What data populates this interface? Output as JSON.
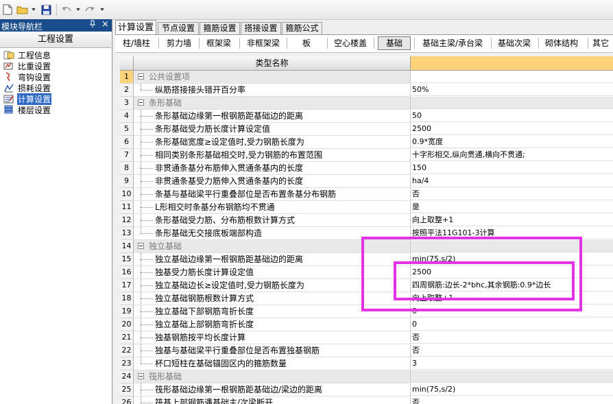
{
  "toolbar": {
    "icons": [
      "new-file-icon",
      "open-folder-icon",
      "save-icon",
      "undo-icon",
      "redo-icon"
    ]
  },
  "nav": {
    "title": "模块导航栏",
    "pin": "ą",
    "close": "×",
    "header": "工程设置",
    "items": [
      {
        "label": "工程信息",
        "icon": "project-info-icon"
      },
      {
        "label": "比重设置",
        "icon": "density-icon"
      },
      {
        "label": "弯钩设置",
        "icon": "hook-icon"
      },
      {
        "label": "损耗设置",
        "icon": "loss-icon"
      },
      {
        "label": "计算设置",
        "icon": "calc-settings-icon",
        "selected": true
      },
      {
        "label": "楼层设置",
        "icon": "floor-settings-icon"
      }
    ]
  },
  "tabs": [
    "计算设置",
    "节点设置",
    "箍筋设置",
    "搭接设置",
    "箍筋公式"
  ],
  "subtabs": [
    "柱/墙柱",
    "剪力墙",
    "框架梁",
    "非框架梁",
    "板",
    "空心楼盖",
    "基础",
    "基础主梁/承台梁",
    "基础次梁",
    "砌体结构",
    "其它"
  ],
  "grid": {
    "header_name": "类型名称",
    "rows": [
      {
        "n": "1",
        "name": "公共设置项",
        "value": "",
        "cat": true
      },
      {
        "n": "2",
        "name": "纵筋搭接接头错开百分率",
        "value": "50%"
      },
      {
        "n": "3",
        "name": "条形基础",
        "value": "",
        "cat": true
      },
      {
        "n": "4",
        "name": "条形基础边缘第一根钢筋距基础边的距离",
        "value": "50"
      },
      {
        "n": "5",
        "name": "条形基础受力筋长度计算设定值",
        "value": "2500"
      },
      {
        "n": "6",
        "name": "条形基础宽度≥设定值时,受力钢筋长度为",
        "value": "0.9*宽度"
      },
      {
        "n": "7",
        "name": "相同类别条形基础相交时,受力钢筋的布置范围",
        "value": "十字形相交,纵向贯通,横向不贯通;"
      },
      {
        "n": "8",
        "name": "非贯通条基分布筋伸入贯通条基内的长度",
        "value": "150"
      },
      {
        "n": "9",
        "name": "非贯通条基受力筋伸入贯通条基内的长度",
        "value": "ha/4"
      },
      {
        "n": "10",
        "name": "条基与基础梁平行重叠部位是否布置条基分布钢筋",
        "value": "否"
      },
      {
        "n": "11",
        "name": "L形相交时条基分布钢筋均不贯通",
        "value": "是"
      },
      {
        "n": "12",
        "name": "条形基础受力筋、分布筋根数计算方式",
        "value": "向上取整+1"
      },
      {
        "n": "13",
        "name": "条形基础无交接底板端部构造",
        "value": "按照平法11G101-3计算"
      },
      {
        "n": "14",
        "name": "独立基础",
        "value": "",
        "cat": true
      },
      {
        "n": "15",
        "name": "独立基础边缘第一根钢筋距基础边的距离",
        "value": "min(75,s/2)"
      },
      {
        "n": "16",
        "name": "独基受力筋长度计算设定值",
        "value": "2500"
      },
      {
        "n": "17",
        "name": "独立基础边长≥设定值时,受力钢筋长度为",
        "value": "四周钢筋:边长-2*bhc,其余钢筋:0.9*边长"
      },
      {
        "n": "18",
        "name": "独立基础钢筋根数计算方式",
        "value": "向上取整+1"
      },
      {
        "n": "19",
        "name": "独立基础下部钢筋弯折长度",
        "value": "0"
      },
      {
        "n": "20",
        "name": "独立基础上部钢筋弯折长度",
        "value": "0"
      },
      {
        "n": "21",
        "name": "独基钢筋按平均长度计算",
        "value": "否"
      },
      {
        "n": "22",
        "name": "独基与基础梁平行重叠部位是否布置独基钢筋",
        "value": "否"
      },
      {
        "n": "23",
        "name": "杯口短柱在基础锚固区内的箍筋数量",
        "value": "3"
      },
      {
        "n": "24",
        "name": "筏形基础",
        "value": "",
        "cat": true
      },
      {
        "n": "25",
        "name": "筏形基础边缘第一根钢筋距基础边/梁边的距离",
        "value": "min(75,s/2)"
      },
      {
        "n": "26",
        "name": "筏基上部钢筋遇基础主/次梁断开",
        "value": "否"
      }
    ]
  },
  "colors": {
    "highlight": "#e233e6",
    "header_value": "#ffd37a",
    "nav_title": "#1a4d8c",
    "selected": "#316ac5"
  }
}
